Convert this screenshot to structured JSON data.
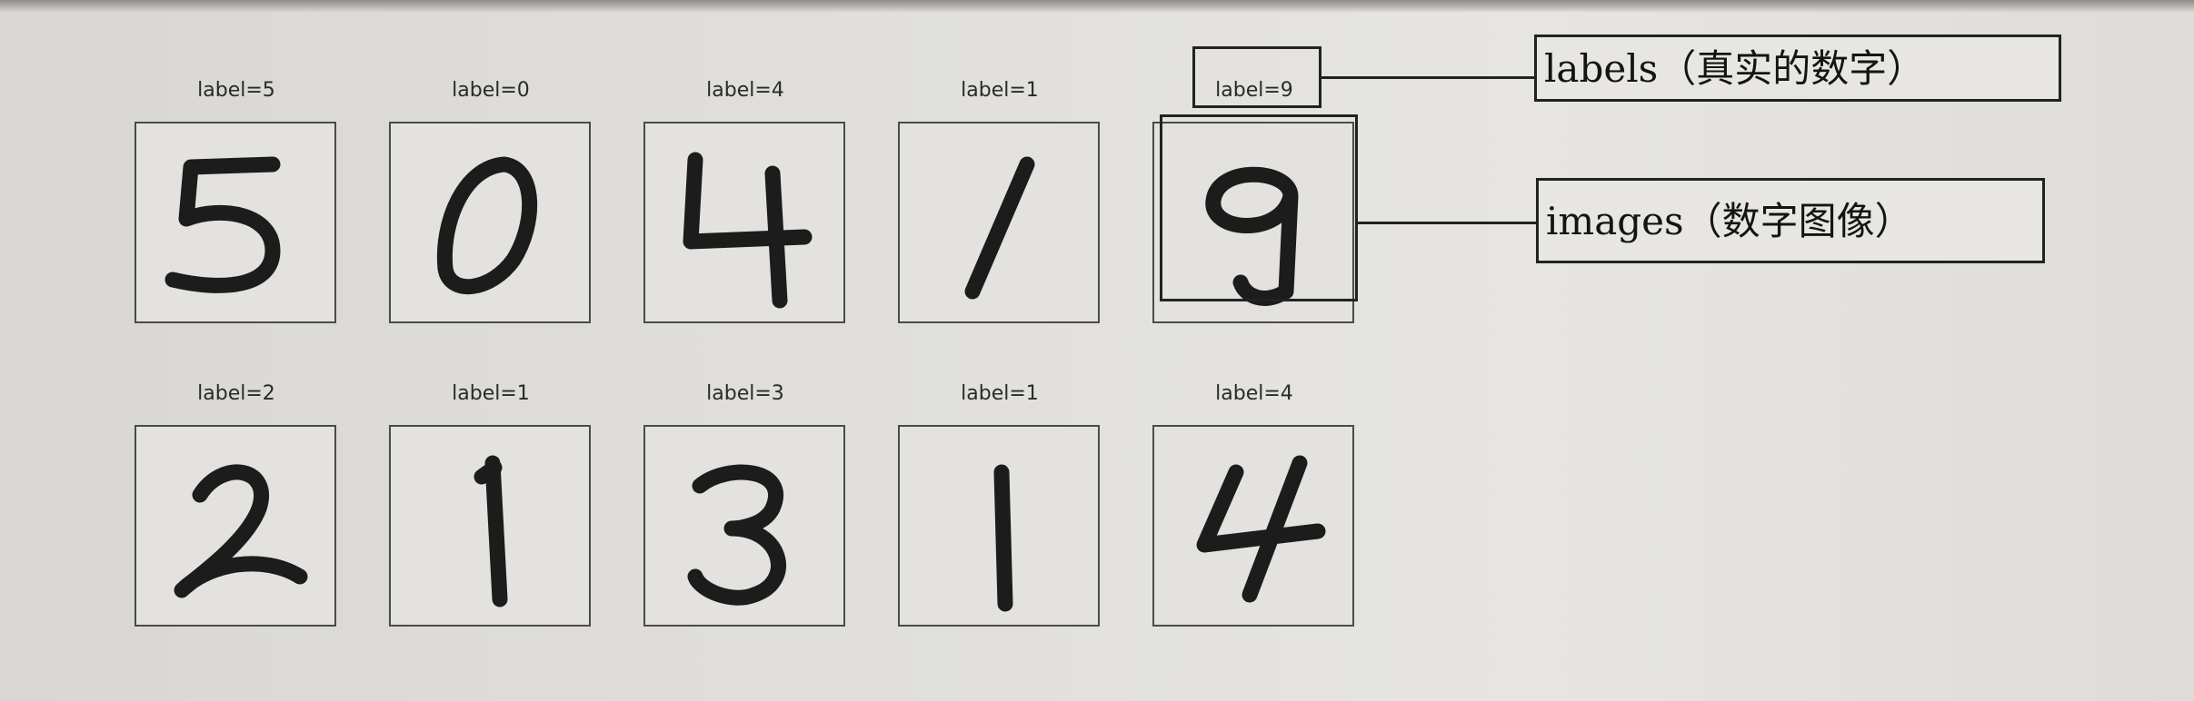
{
  "digits": [
    {
      "label": "label=5"
    },
    {
      "label": "label=0"
    },
    {
      "label": "label=4"
    },
    {
      "label": "label=1"
    },
    {
      "label": "label=9"
    },
    {
      "label": "label=2"
    },
    {
      "label": "label=1"
    },
    {
      "label": "label=3"
    },
    {
      "label": "label=1"
    },
    {
      "label": "label=4"
    }
  ],
  "annotations": {
    "labels": "labels（真实的数字）",
    "images": "images（数字图像）"
  }
}
